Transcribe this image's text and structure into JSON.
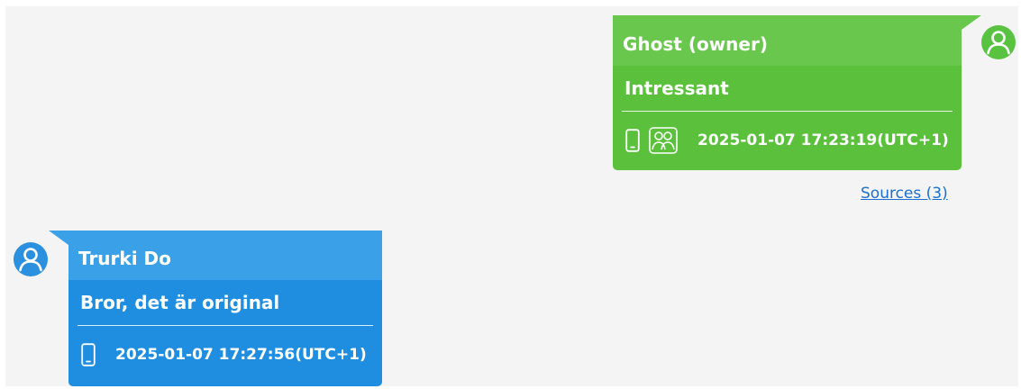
{
  "owner_message": {
    "sender": "Ghost (owner)",
    "text": "Intressant",
    "timestamp": "2025-01-07 17:23:19(UTC+1)",
    "icons": [
      "phone-icon",
      "group-icon"
    ],
    "color": "#5bc13c",
    "sources_link": "Sources (3)"
  },
  "contact_message": {
    "sender": "Trurki Do",
    "text": "Bror, det är original",
    "timestamp": "2025-01-07 17:27:56(UTC+1)",
    "icons": [
      "phone-icon"
    ],
    "color": "#1f8ee0"
  }
}
